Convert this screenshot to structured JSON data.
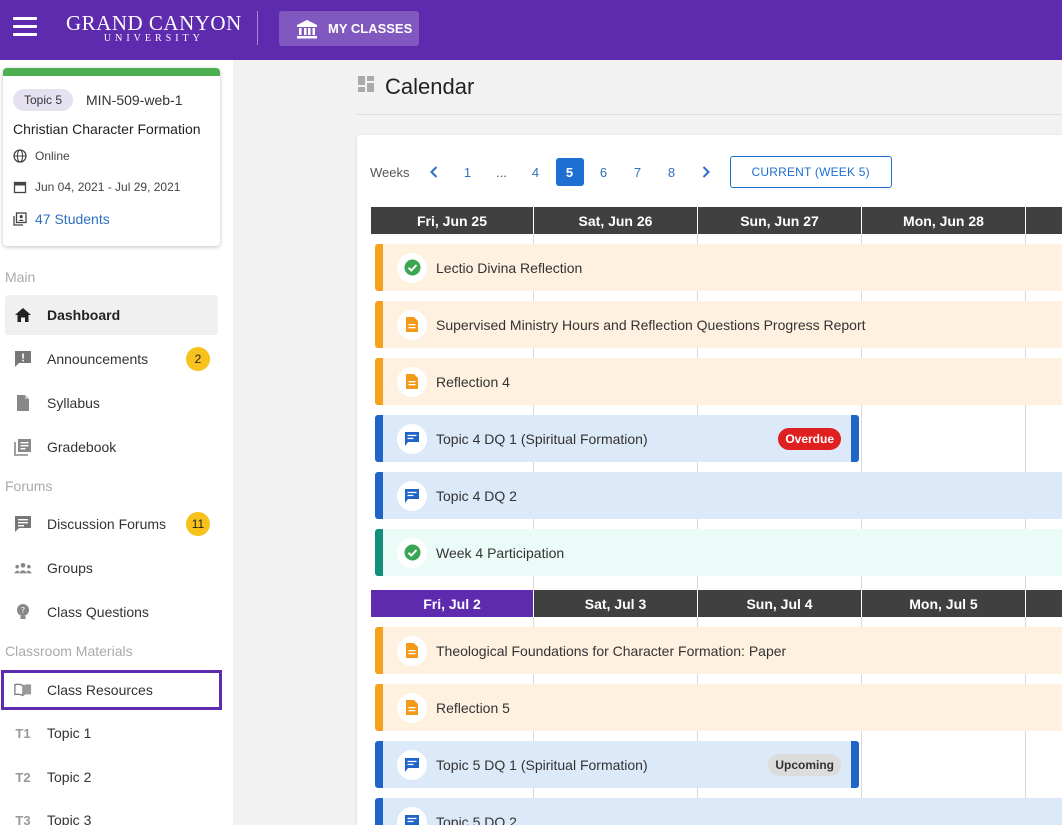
{
  "header": {
    "logo_line1": "GRAND CANYON",
    "logo_line2": "UNIVERSITY",
    "my_classes_label": "MY CLASSES"
  },
  "course": {
    "topic": "Topic 5",
    "code": "MIN-509-web-1",
    "name": "Christian Character Formation",
    "mode": "Online",
    "dates": "Jun 04, 2021 - Jul 29, 2021",
    "students": "47 Students",
    "accent_color": "#4caf50"
  },
  "sidebar": {
    "sections": {
      "main": "Main",
      "forums": "Forums",
      "materials": "Classroom Materials"
    },
    "items": [
      {
        "label": "Dashboard",
        "icon": "home-icon"
      },
      {
        "label": "Announcements",
        "icon": "announcement-icon",
        "badge": "2"
      },
      {
        "label": "Syllabus",
        "icon": "document-icon"
      },
      {
        "label": "Gradebook",
        "icon": "gradebook-icon"
      },
      {
        "label": "Discussion Forums",
        "icon": "forum-icon",
        "badge": "11"
      },
      {
        "label": "Groups",
        "icon": "groups-icon"
      },
      {
        "label": "Class Questions",
        "icon": "question-icon"
      },
      {
        "label": "Class Resources",
        "icon": "book-icon"
      },
      {
        "label": "Topic 1",
        "code": "T1"
      },
      {
        "label": "Topic 2",
        "code": "T2"
      },
      {
        "label": "Topic 3",
        "code": "T3"
      }
    ]
  },
  "calendar": {
    "title": "Calendar",
    "weeks_label": "Weeks",
    "pages": [
      "1",
      "...",
      "4",
      "5",
      "6",
      "7",
      "8"
    ],
    "active_page": "5",
    "current_week_label": "CURRENT (WEEK 5)",
    "week1": {
      "days": [
        "Fri, Jun 25",
        "Sat, Jun 26",
        "Sun, Jun 27",
        "Mon, Jun 28"
      ],
      "events": [
        {
          "title": "Lectio Divina Reflection",
          "type": "check",
          "color": "orange"
        },
        {
          "title": "Supervised Ministry Hours and Reflection Questions Progress Report",
          "type": "doc",
          "color": "orange"
        },
        {
          "title": "Reflection 4",
          "type": "doc",
          "color": "orange"
        },
        {
          "title": "Topic 4 DQ 1 (Spiritual Formation)",
          "type": "chat",
          "color": "blue",
          "status": "Overdue"
        },
        {
          "title": "Topic 4 DQ 2",
          "type": "chat",
          "color": "blue"
        },
        {
          "title": "Week 4 Participation",
          "type": "check",
          "color": "teal"
        }
      ]
    },
    "week2": {
      "days": [
        "Fri, Jul 2",
        "Sat, Jul 3",
        "Sun, Jul 4",
        "Mon, Jul 5"
      ],
      "events": [
        {
          "title": "Theological Foundations for Character Formation: Paper",
          "type": "doc",
          "color": "orange"
        },
        {
          "title": "Reflection 5",
          "type": "doc",
          "color": "orange"
        },
        {
          "title": "Topic 5 DQ 1 (Spiritual Formation)",
          "type": "chat",
          "color": "blue",
          "status": "Upcoming"
        },
        {
          "title": "Topic 5 DQ 2",
          "type": "chat",
          "color": "blue"
        }
      ]
    }
  },
  "colors": {
    "brand_purple": "#5e2aae",
    "primary_blue": "#1d6fd1",
    "overdue_red": "#e02020",
    "badge_yellow": "#f7c21b"
  }
}
